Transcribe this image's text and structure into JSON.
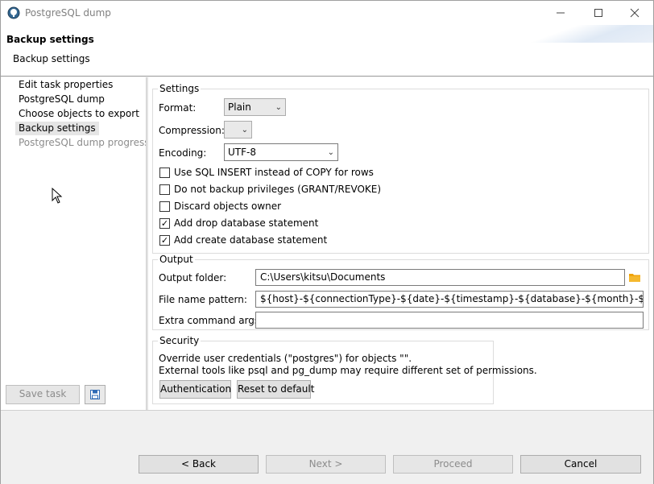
{
  "window": {
    "title": "PostgreSQL dump",
    "controls": {
      "minimize_icon": "minimize-icon",
      "maximize_icon": "maximize-icon",
      "close_icon": "close-icon"
    }
  },
  "header": {
    "title": "Backup settings",
    "subtitle": "Backup settings"
  },
  "nav": {
    "items": [
      {
        "label": "Edit task properties",
        "state": "normal"
      },
      {
        "label": "PostgreSQL dump",
        "state": "normal"
      },
      {
        "label": "Choose objects to export",
        "state": "normal"
      },
      {
        "label": "Backup settings",
        "state": "selected"
      },
      {
        "label": "PostgreSQL dump progress",
        "state": "disabled"
      }
    ],
    "save_task": "Save task",
    "save_icon": "save-icon"
  },
  "settings": {
    "title": "Settings",
    "format_label": "Format:",
    "format_value": "Plain",
    "compression_label": "Compression:",
    "compression_value": "",
    "encoding_label": "Encoding:",
    "encoding_value": "UTF-8",
    "checkboxes": [
      {
        "label": "Use SQL INSERT instead of COPY for rows",
        "checked": false
      },
      {
        "label": "Do not backup privileges (GRANT/REVOKE)",
        "checked": false
      },
      {
        "label": "Discard objects owner",
        "checked": false
      },
      {
        "label": "Add drop database statement",
        "checked": true
      },
      {
        "label": "Add create database statement",
        "checked": true
      }
    ]
  },
  "output": {
    "title": "Output",
    "folder_label": "Output folder:",
    "folder_value": "C:\\Users\\kitsu\\Documents",
    "pattern_label": "File name pattern:",
    "pattern_value": "${host}-${connectionType}-${date}-${timestamp}-${database}-${month}-${year}-${day}-${",
    "args_label": "Extra command args:",
    "args_value": ""
  },
  "security": {
    "title": "Security",
    "line1": "Override user credentials (\"postgres\") for objects \"\".",
    "line2": "External tools like psql and pg_dump may require different set of permissions.",
    "auth_button": "Authentication",
    "reset_button": "Reset to default"
  },
  "footer": {
    "back": "< Back",
    "next": "Next >",
    "proceed": "Proceed",
    "cancel": "Cancel"
  },
  "colors": {
    "folder_icon": "#f0a30a",
    "selected_bg": "#e5e5e5",
    "disabled_text": "#8c8c8c"
  }
}
